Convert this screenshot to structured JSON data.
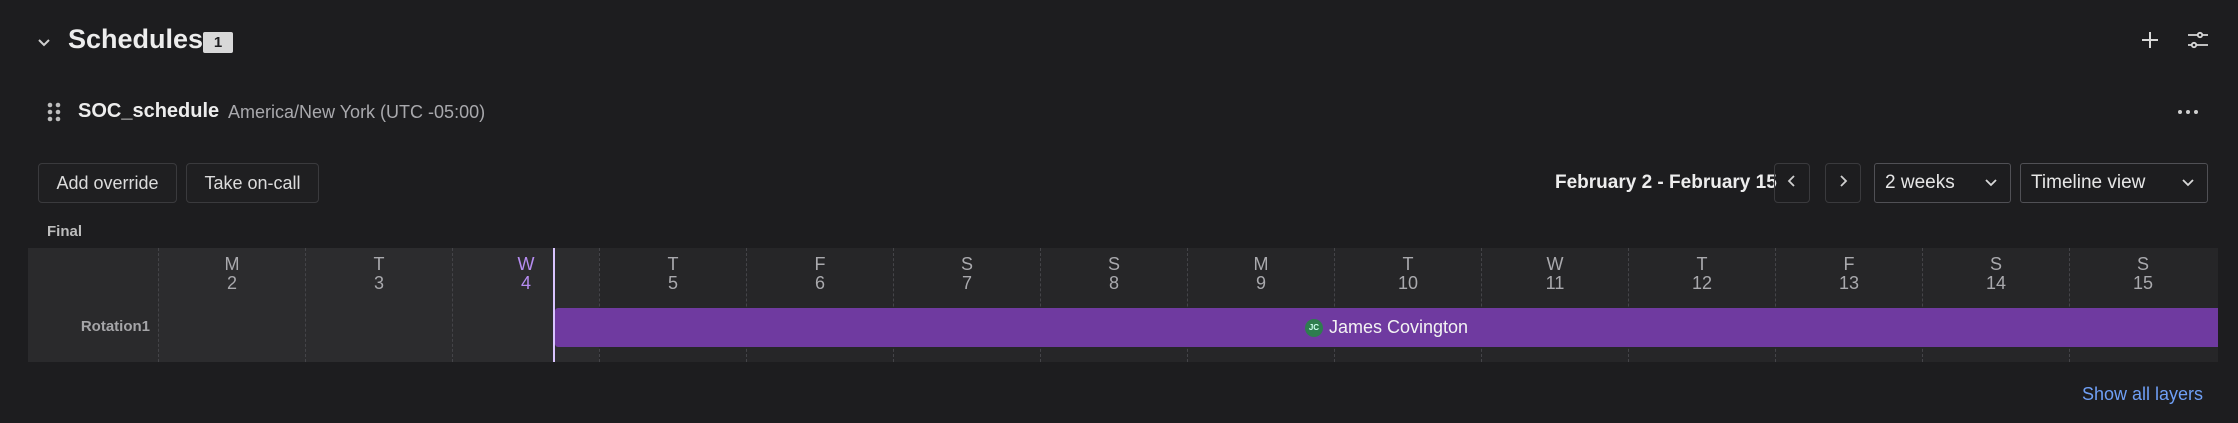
{
  "section": {
    "title": "Schedules",
    "count": "1"
  },
  "icons": {
    "collapse": "chevron-down-icon",
    "add": "plus-icon",
    "filter": "sliders-icon",
    "drag": "drag-handle-icon",
    "more": "more-horizontal-icon",
    "prev": "chevron-left-icon",
    "next": "chevron-right-icon"
  },
  "schedule": {
    "name": "SOC_schedule",
    "timezone": "America/New York (UTC -05:00)"
  },
  "toolbar": {
    "add_override": "Add override",
    "take_oncall": "Take on-call",
    "range": "February 2 - February 15",
    "period": "2 weeks",
    "view": "Timeline view"
  },
  "layer_label": "Final",
  "days": [
    {
      "name": "M",
      "num": "2"
    },
    {
      "name": "T",
      "num": "3"
    },
    {
      "name": "W",
      "num": "4"
    },
    {
      "name": "T",
      "num": "5"
    },
    {
      "name": "F",
      "num": "6"
    },
    {
      "name": "S",
      "num": "7"
    },
    {
      "name": "S",
      "num": "8"
    },
    {
      "name": "M",
      "num": "9"
    },
    {
      "name": "T",
      "num": "10"
    },
    {
      "name": "W",
      "num": "11"
    },
    {
      "name": "T",
      "num": "12"
    },
    {
      "name": "F",
      "num": "13"
    },
    {
      "name": "S",
      "num": "14"
    },
    {
      "name": "S",
      "num": "15"
    }
  ],
  "today_index": 2,
  "rotation": {
    "label": "Rotation1",
    "oncall_initials": "JC",
    "oncall_name": "James Covington"
  },
  "colors": {
    "shift": "#6f3aa0",
    "today": "#b58cf0",
    "link": "#6f9ff5"
  },
  "footer": {
    "show_all": "Show all layers"
  }
}
